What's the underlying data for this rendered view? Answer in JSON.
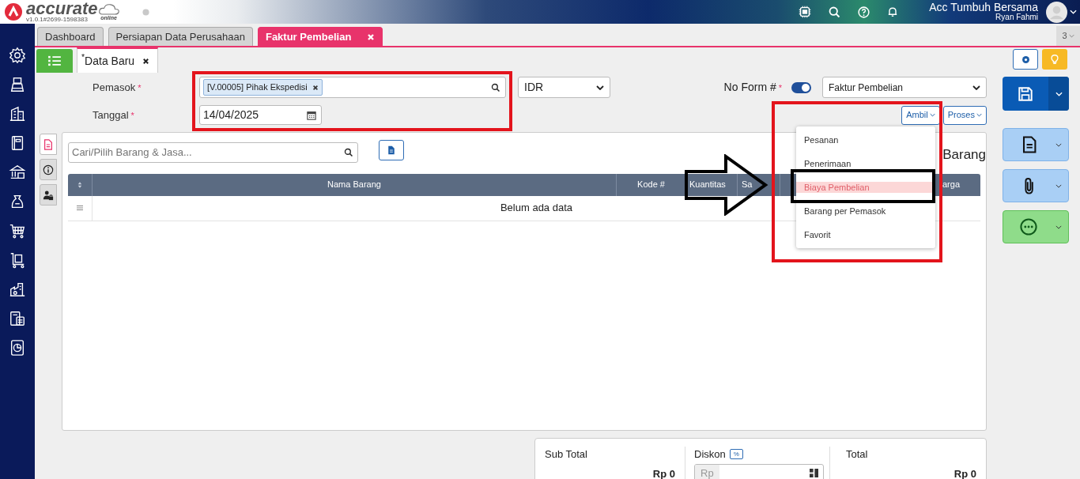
{
  "header": {
    "logo_text": "accurate",
    "logo_sub": "online",
    "version": "v1.0.1#2699-1598383",
    "company": "Acc Tumbuh Bersama",
    "user": "Ryan Fahmi"
  },
  "tabs": [
    {
      "label": "Dashboard",
      "selected": false
    },
    {
      "label": "Persiapan Data Perusahaan",
      "selected": false
    },
    {
      "label": "Faktur Pembelian",
      "selected": true
    }
  ],
  "tab_count": "3",
  "doc_tab": {
    "label": "$^{*}$Data Baru"
  },
  "form": {
    "supplier": {
      "label": "Pemasok",
      "mark": "*",
      "tag": "[V.00005] Pihak Ekspedisi"
    },
    "currency": "IDR",
    "date": {
      "label": "Tanggal",
      "mark": "*",
      "value": "14/04/2025"
    },
    "form_no": {
      "label": "No Form #",
      "mark": "*",
      "on": true
    },
    "form_type": "Faktur Pembelian",
    "buttons": [
      "Ambil",
      "Proses"
    ]
  },
  "menu": [
    {
      "label": "Pesanan",
      "selected": false
    },
    {
      "label": "Penerimaan",
      "selected": false
    },
    {
      "label": "Biaya Pembelian",
      "selected": true
    },
    {
      "label": "Barang per Pemasok",
      "selected": false
    },
    {
      "label": "Favorit",
      "selected": false
    }
  ],
  "detail": {
    "side_tabs": [
      {
        "selected": true
      },
      {
        "selected": false
      },
      {
        "selected": false
      }
    ],
    "search": {
      "placeholder": "Cari/Pilih Barang & Jasa..."
    },
    "title": "Barang",
    "columns": [
      "Nama Barang",
      "Kode #",
      "Kuantitas",
      "Sa",
      "arga"
    ],
    "empty": "Belum ada data"
  },
  "summary": {
    "subtotal_label": "Sub Total",
    "subtotal": "Rp 0",
    "discount_label": "Diskon",
    "discount_unit": "%",
    "discount_prefix": "Rp",
    "total_label": "Total",
    "total": "Rp 0"
  },
  "annotations": [
    {
      "kind": "box",
      "color": "#e3141c"
    },
    {
      "kind": "box",
      "color": "#e3141c"
    },
    {
      "kind": "box",
      "color": "#000000"
    },
    {
      "kind": "arrow",
      "color": "#000000"
    }
  ]
}
